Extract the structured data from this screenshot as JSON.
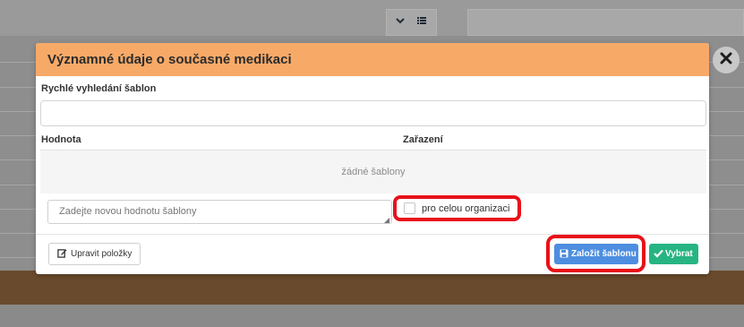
{
  "background": {
    "toolbar_icons": [
      "chevron-down-icon",
      "list-icon"
    ]
  },
  "modal": {
    "title": "Významné údaje o současné medikaci",
    "quick_search_label": "Rychlé vyhledání šablon",
    "search_value": "",
    "table": {
      "columns": [
        "Hodnota",
        "Zařazení"
      ],
      "empty_text": "žádné šablony"
    },
    "new_value_placeholder": "Zadejte novou hodnotu šablony",
    "org_checkbox": {
      "label": "pro celou organizaci",
      "checked": false
    },
    "buttons": {
      "edit_label": "Upravit položky",
      "create_label": "Založit šablonu",
      "select_label": "Vybrat"
    }
  },
  "colors": {
    "header": "#f7aa68",
    "create_button": "#4d8ee0",
    "select_button": "#27b483",
    "highlight": "#e8101a"
  }
}
